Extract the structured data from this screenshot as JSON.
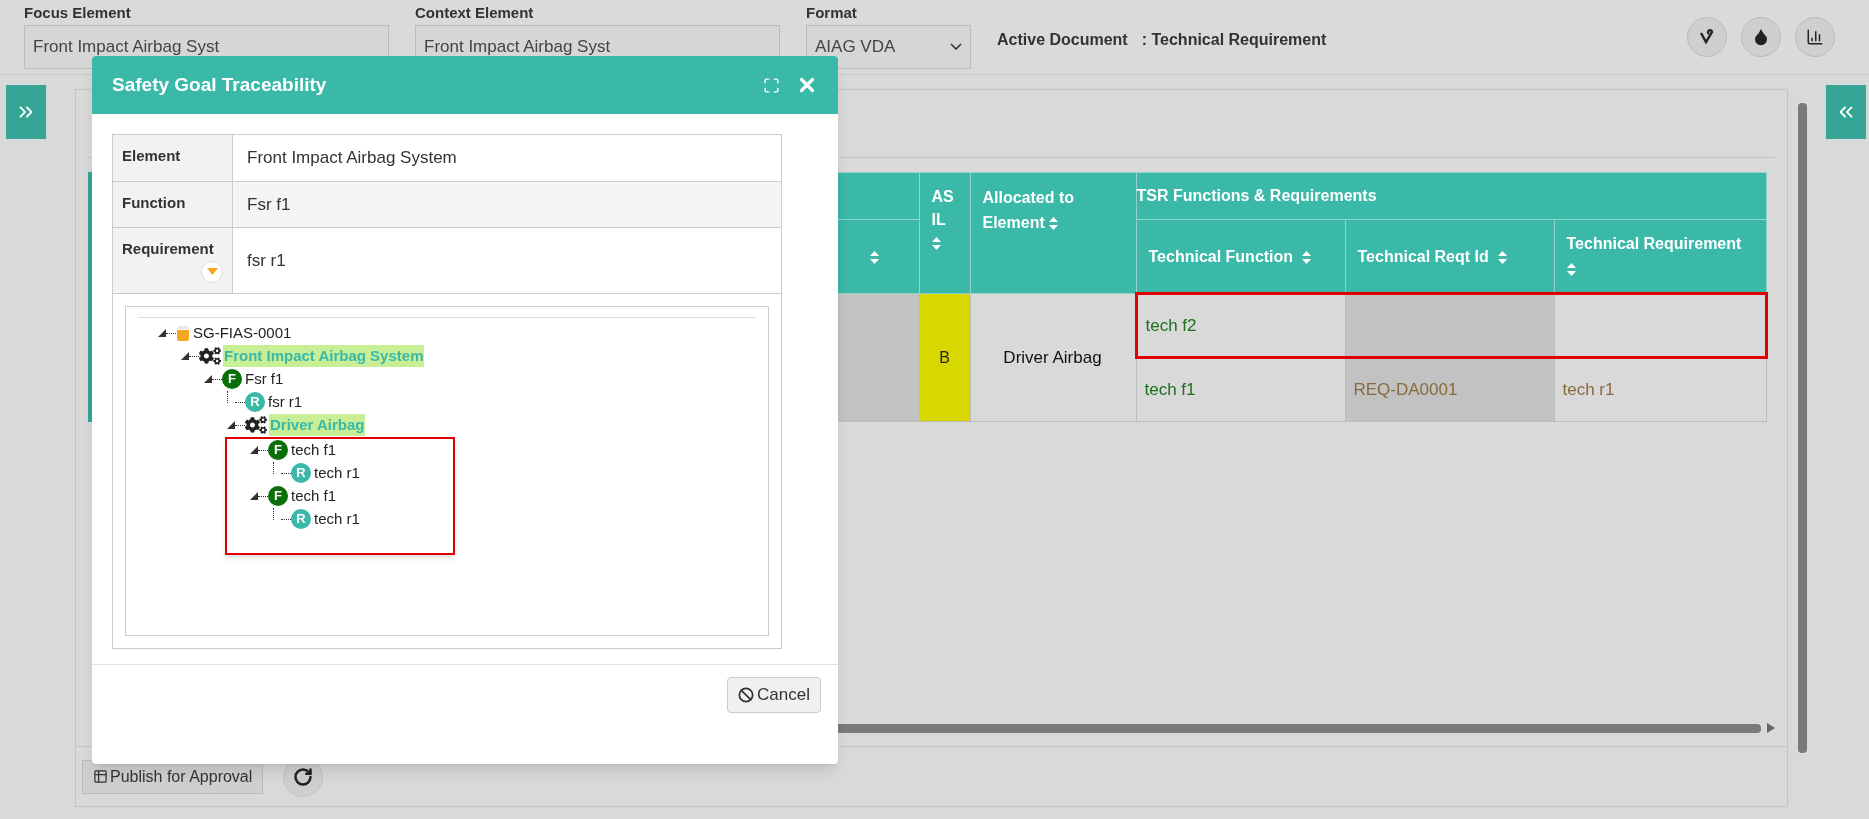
{
  "top_bar": {
    "fields": [
      {
        "kind": "text",
        "label": "Focus Element",
        "value": "Front Impact Airbag Syst"
      },
      {
        "kind": "text",
        "label": "Context Element",
        "value": "Front Impact Airbag Syst"
      },
      {
        "kind": "select",
        "label": "Format",
        "value": "AIAG VDA"
      }
    ],
    "active_document": {
      "label": "Active Document",
      "value": ": Technical Requirement"
    }
  },
  "table": {
    "group_header": "TSR Functions & Requirements",
    "columns": [
      {
        "label": "ASIL"
      },
      {
        "label": "Allocated to Element"
      }
    ],
    "group_columns": [
      {
        "label": "Technical Function"
      },
      {
        "label": "Technical Reqt Id"
      },
      {
        "label": "Technical Requirement"
      }
    ],
    "asil": "B",
    "allocated_to": "Driver Airbag",
    "rows": [
      {
        "technical_function": "tech f2",
        "technical_reqt_id": "",
        "technical_requirement": "",
        "outlined": true
      },
      {
        "technical_function": "tech f1",
        "technical_reqt_id": "REQ-DA0001",
        "technical_requirement": "tech r1",
        "outlined": false
      }
    ]
  },
  "footer": {
    "publish_button": "Publish for Approval"
  },
  "dialog": {
    "title": "Safety Goal Traceability",
    "details": [
      {
        "label": "Element",
        "value": "Front Impact Airbag System",
        "dropdown": false
      },
      {
        "label": "Function",
        "value": "Fsr f1",
        "dropdown": false
      },
      {
        "label": "Requirement",
        "value": "fsr r1",
        "dropdown": true
      }
    ],
    "tree": [
      {
        "kind": "goal",
        "label": "SG-FIAS-0001",
        "highlighted": false,
        "children": [
          {
            "kind": "component",
            "label": "Front Impact Airbag System",
            "highlighted": true,
            "children": [
              {
                "kind": "function",
                "badge": "F",
                "label": "Fsr f1",
                "highlighted": false,
                "children": [
                  {
                    "kind": "requirement",
                    "badge": "R",
                    "label": "fsr r1",
                    "highlighted": false
                  },
                  {
                    "kind": "component",
                    "label": "Driver Airbag",
                    "highlighted": true,
                    "outline_children": true,
                    "children": [
                      {
                        "kind": "function",
                        "badge": "F",
                        "label": "tech f1",
                        "highlighted": false,
                        "children": [
                          {
                            "kind": "requirement",
                            "badge": "R",
                            "label": "tech r1",
                            "highlighted": false
                          }
                        ]
                      },
                      {
                        "kind": "function",
                        "badge": "F",
                        "label": "tech f1",
                        "highlighted": false,
                        "children": [
                          {
                            "kind": "requirement",
                            "badge": "R",
                            "label": "tech r1",
                            "highlighted": false
                          }
                        ]
                      }
                    ]
                  }
                ]
              }
            ]
          }
        ]
      }
    ],
    "cancel_button": "Cancel"
  }
}
